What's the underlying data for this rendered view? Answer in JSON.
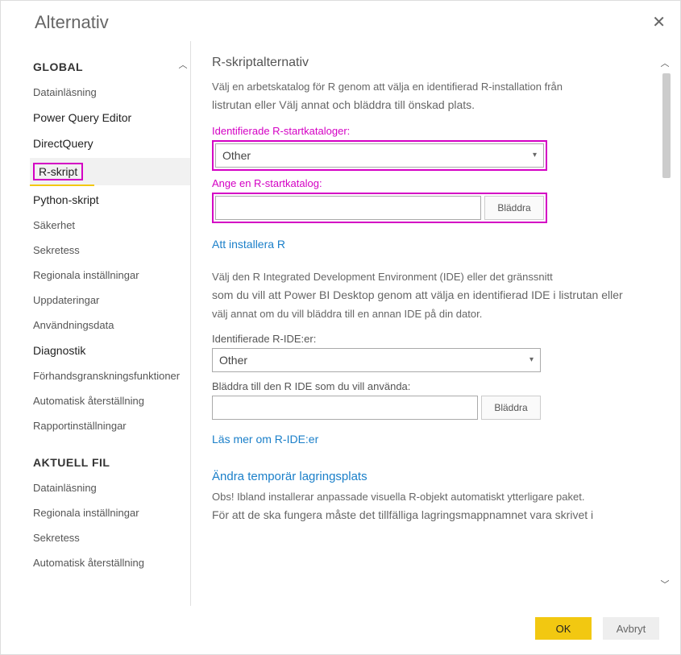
{
  "window": {
    "title": "Alternativ"
  },
  "sidebar": {
    "section1": "GLOBAL",
    "items1": [
      {
        "label": "Datainläsning"
      },
      {
        "label": "Power Query Editor"
      },
      {
        "label": "DirectQuery"
      },
      {
        "label": "R-skript"
      },
      {
        "label": "Python-skript"
      },
      {
        "label": "Säkerhet"
      },
      {
        "label": "Sekretess"
      },
      {
        "label": "Regionala inställningar"
      },
      {
        "label": "Uppdateringar"
      },
      {
        "label": "Användningsdata"
      },
      {
        "label": "Diagnostik"
      },
      {
        "label": "Förhandsgranskningsfunktioner"
      },
      {
        "label": "Automatisk återställning"
      },
      {
        "label": "Rapportinställningar"
      }
    ],
    "section2": "AKTUELL FIL",
    "items2": [
      {
        "label": "Datainläsning"
      },
      {
        "label": "Regionala inställningar"
      },
      {
        "label": "Sekretess"
      },
      {
        "label": "Automatisk återställning"
      }
    ]
  },
  "main": {
    "heading": "R-skriptalternativ",
    "desc1a": "Välj en arbetskatalog för R genom att välja en identifierad R-installation från",
    "desc1b": "listrutan eller Välj annat och bläddra till önskad plats.",
    "label_detected_home": "Identifierade R-startkataloger:",
    "select_home_value": "Other",
    "label_set_home": "Ange en R-startkatalog:",
    "home_value": "",
    "browse": "Bläddra",
    "link_install": "Att installera R",
    "desc2a": "Välj den R Integrated Development Environment (IDE) eller det gränssnitt",
    "desc2b": "som du vill att Power BI Desktop genom att välja en identifierad IDE i listrutan eller",
    "desc2c": "välj annat om du vill bläddra till en annan IDE på din dator.",
    "label_detected_ide": "Identifierade R-IDE:er:",
    "select_ide_value": "Other",
    "label_browse_ide": "Bläddra till den R IDE som du vill använda:",
    "ide_value": "",
    "link_ide": "Läs mer om R-IDE:er",
    "heading_temp": "Ändra temporär lagringsplats",
    "temp_note1": "Obs! Ibland installerar anpassade visuella R-objekt automatiskt ytterligare paket.",
    "temp_note2": "För att de ska fungera måste det tillfälliga lagringsmappnamnet vara skrivet i"
  },
  "footer": {
    "ok": "OK",
    "cancel": "Avbryt"
  }
}
